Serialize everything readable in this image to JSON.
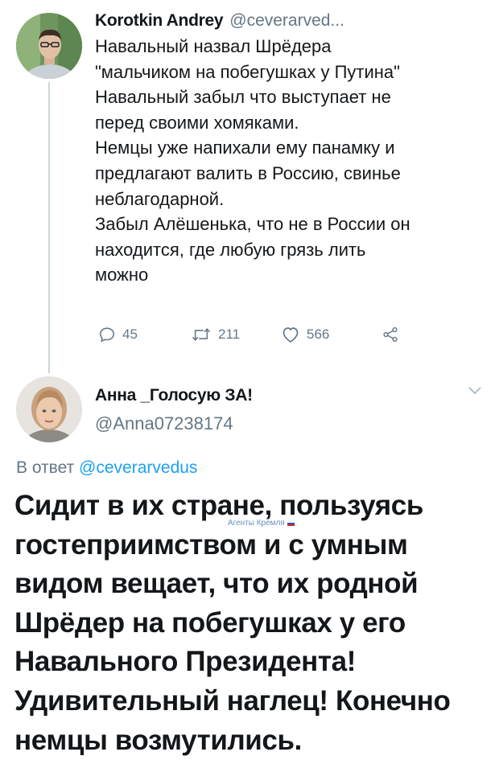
{
  "tweet1": {
    "author_name": "Korotkin Andrey",
    "author_handle": "@ceverarved...",
    "text_lines": [
      "Навальный назвал Шрёдера",
      "\"мальчиком на побегушках у Путина\"",
      "Навальный забыл что выступает не",
      "перед своими хомяками.",
      "Немцы уже напихали ему панамку и",
      "предлагают валить в Россию,  свинье",
      "неблагодарной.",
      "Забыл Алёшенька,  что не в России он",
      "находится,  где любую грязь лить",
      "можно"
    ],
    "replies": "45",
    "retweets": "211",
    "likes": "566",
    "icons": [
      "reply-icon",
      "retweet-icon",
      "like-icon",
      "share-icon"
    ]
  },
  "tweet2": {
    "author_name": "Анна _Голосую ЗА!",
    "author_handle": "@Anna07238174",
    "reply_prefix": "В ответ",
    "reply_to": "@ceverarvedus",
    "text_lines": [
      "Сидит в их стране, пользуясь",
      "гостеприимством и с умным",
      "видом вещает, что их родной",
      "Шрёдер на побегушках у его",
      "Навального Президента!",
      "Удивительный наглец! Конечно",
      "немцы возмутились."
    ]
  },
  "watermark": "Агенты Кремля",
  "colors": {
    "text": "#14171a",
    "muted": "#657786",
    "link": "#1da1f2",
    "thread": "#ccd6dd"
  }
}
